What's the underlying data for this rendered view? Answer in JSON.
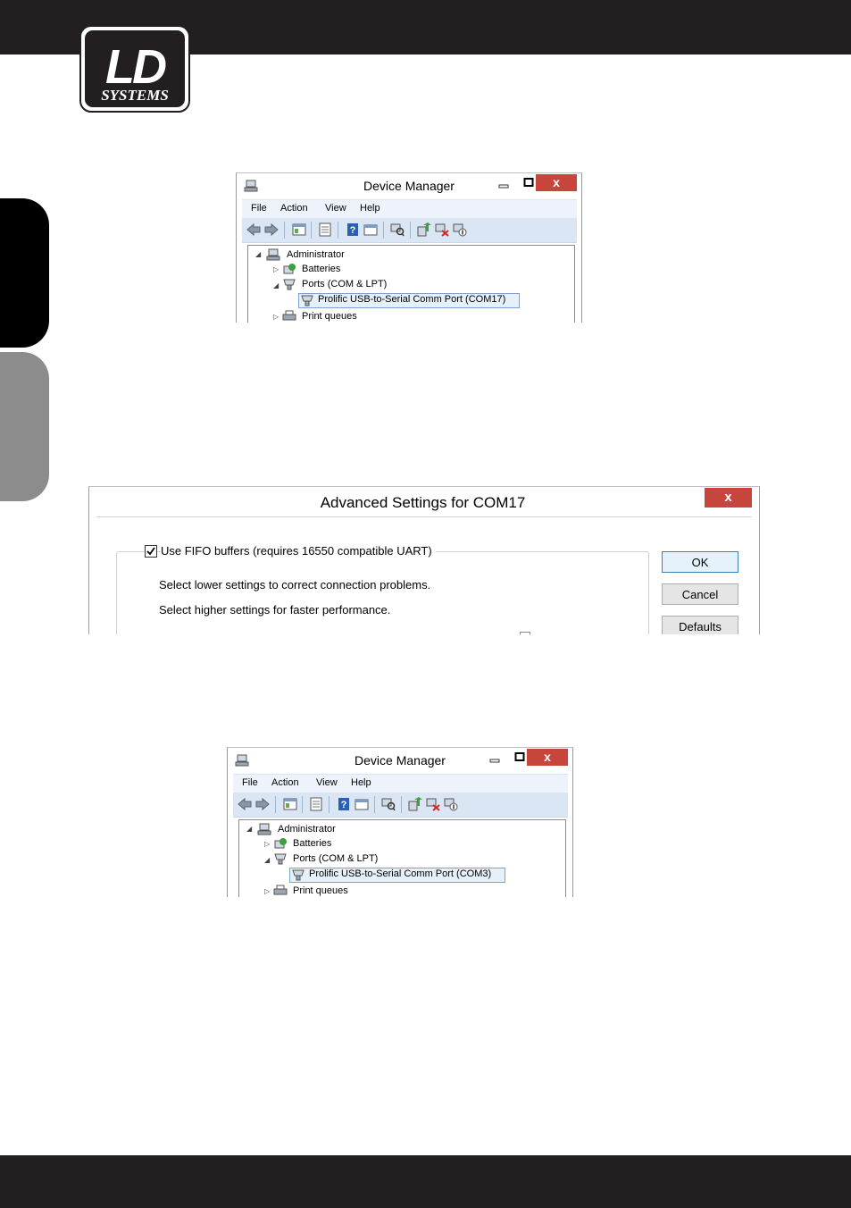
{
  "brand": {
    "logo_text_top": "LD",
    "logo_text_bottom": "SYSTEMS"
  },
  "device_manager_1": {
    "title": "Device Manager",
    "minimize": "▭",
    "maximize": "□",
    "close": "x",
    "menu": [
      "File",
      "Action",
      "View",
      "Help"
    ],
    "tree": {
      "root": "Administrator",
      "batteries": "Batteries",
      "ports": "Ports (COM & LPT)",
      "port_device": "Prolific USB-to-Serial Comm Port (COM17)",
      "print_queues": "Print queues"
    }
  },
  "advanced_settings": {
    "title": "Advanced Settings for COM17",
    "close": "x",
    "fifo_label": "Use FIFO buffers (requires 16550 compatible UART)",
    "fifo_checked": true,
    "line1": "Select lower settings to correct connection problems.",
    "line2": "Select higher settings for faster performance.",
    "buttons": {
      "ok": "OK",
      "cancel": "Cancel",
      "defaults": "Defaults"
    }
  },
  "device_manager_2": {
    "title": "Device Manager",
    "minimize": "▭",
    "maximize": "□",
    "close": "x",
    "menu": [
      "File",
      "Action",
      "View",
      "Help"
    ],
    "tree": {
      "root": "Administrator",
      "batteries": "Batteries",
      "ports": "Ports (COM & LPT)",
      "port_device": "Prolific USB-to-Serial Comm Port (COM3)",
      "print_queues": "Print queues"
    }
  },
  "colors": {
    "bars": "#231f20",
    "close_button": "#c7463b",
    "toolbar": "#dbe6f4",
    "selection": "#e5f0fb"
  }
}
